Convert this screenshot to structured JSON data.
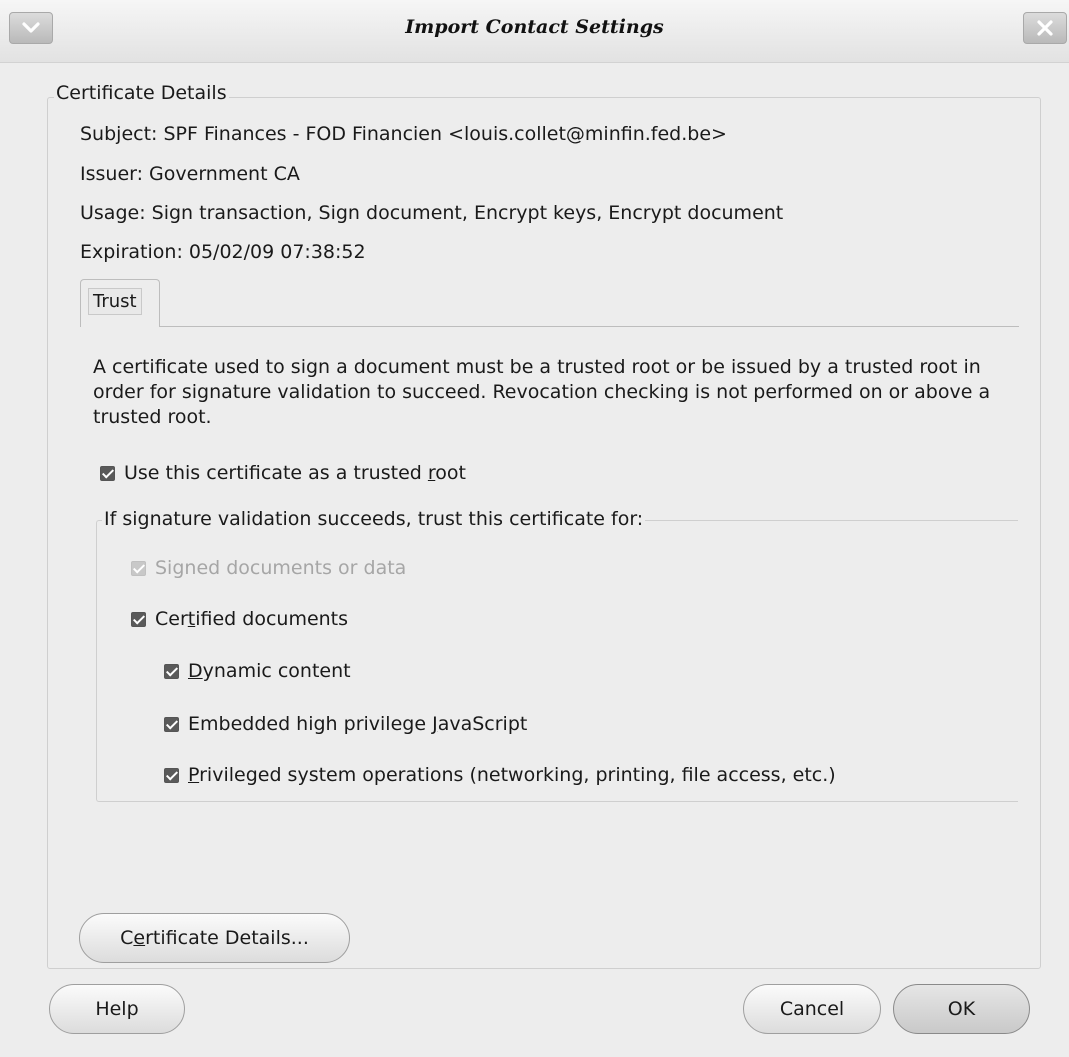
{
  "window": {
    "title": "Import Contact Settings"
  },
  "certificate_group": {
    "title": "Certificate Details",
    "subject": "Subject: SPF Finances - FOD Financien <louis.collet@minfin.fed.be>",
    "issuer": "Issuer: Government CA",
    "usage": "Usage: Sign transaction, Sign document, Encrypt keys, Encrypt document",
    "expiration": "Expiration: 05/02/09 07:38:52"
  },
  "tabs": [
    {
      "label": "Trust",
      "selected": true
    }
  ],
  "trust": {
    "description": "A certificate used to sign a document must be a trusted root or be issued by a trusted root in order for signature validation to succeed. Revocation checking is not performed on or above a trusted root.",
    "trusted_root": {
      "pre": "Use this certificate as a trusted ",
      "mnemonic": "r",
      "post": "oot",
      "checked": true
    },
    "validation_group_title": "If signature validation succeeds, trust this certificate for:",
    "signed_documents": {
      "label": "Signed documents or data",
      "checked": true,
      "disabled": true
    },
    "certified_documents": {
      "pre": "Cer",
      "mnemonic": "t",
      "post": "ified documents",
      "checked": true
    },
    "dynamic_content": {
      "pre": "",
      "mnemonic": "D",
      "post": "ynamic content",
      "checked": true
    },
    "javascript": {
      "pre": "Embedded high privilege ",
      "mnemonic": "J",
      "post": "avaScript",
      "checked": true
    },
    "privileged_ops": {
      "pre": "",
      "mnemonic": "P",
      "post": "rivileged system operations (networking, printing, file access, etc.)",
      "checked": true
    }
  },
  "buttons": {
    "certificate_details": {
      "pre": "C",
      "mnemonic": "e",
      "post": "rtificate Details..."
    },
    "help": "Help",
    "cancel": "Cancel",
    "ok": "OK"
  },
  "icons": {
    "menu": "chevron-down-icon",
    "close": "close-icon"
  }
}
